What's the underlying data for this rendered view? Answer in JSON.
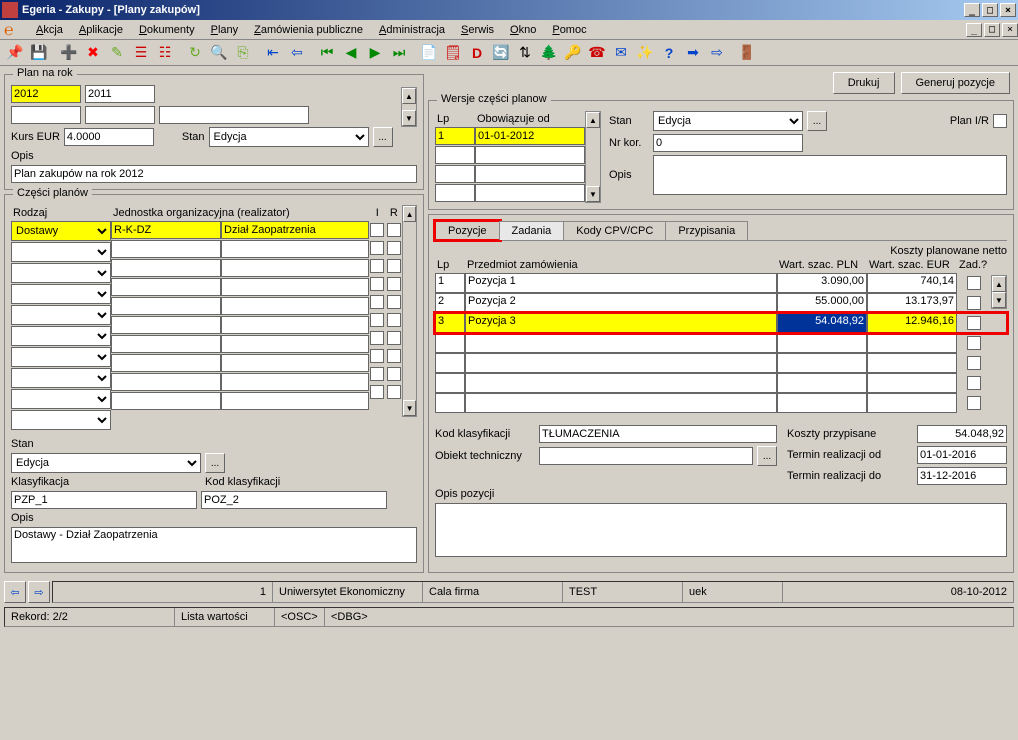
{
  "title": "Egeria - Zakupy - [Plany zakupów]",
  "menu": [
    "Akcja",
    "Aplikacje",
    "Dokumenty",
    "Plany",
    "Zamówienia publiczne",
    "Administracja",
    "Serwis",
    "Okno",
    "Pomoc"
  ],
  "buttons": {
    "print": "Drukuj",
    "gen": "Generuj pozycje"
  },
  "planrok": {
    "title": "Plan na rok",
    "year1": "2012",
    "year2": "2011",
    "kursLabel": "Kurs EUR",
    "kurs": "4.0000",
    "stanLabel": "Stan",
    "stan": "Edycja",
    "opisLabel": "Opis",
    "opis": "Plan zakupów na rok 2012"
  },
  "wersje": {
    "title": "Wersje części planow",
    "lpLabel": "Lp",
    "obowLabel": "Obowiązuje od",
    "lp": "1",
    "obow": "01-01-2012",
    "stanLabel": "Stan",
    "stan": "Edycja",
    "nrkorLabel": "Nr kor.",
    "nrkor": "0",
    "opisLabel": "Opis",
    "planirLabel": "Plan I/R"
  },
  "czesci": {
    "title": "Części planów",
    "rodzajLabel": "Rodzaj",
    "jedLabel": "Jednostka organizacyjna (realizator)",
    "iLabel": "I",
    "rLabel": "R",
    "rodzaj": "Dostawy",
    "jed1": "R-K-DZ",
    "jed2": "Dział Zaopatrzenia",
    "stanLabel": "Stan",
    "stan": "Edycja",
    "klasLabel": "Klasyfikacja",
    "klas": "PZP_1",
    "kodLabel": "Kod klasyfikacji",
    "kod": "POZ_2",
    "opisLabel": "Opis",
    "opis": "Dostawy - Dział Zaopatrzenia"
  },
  "tabs": {
    "pozycje": "Pozycje",
    "zadania": "Zadania",
    "kody": "Kody CPV/CPC",
    "przyp": "Przypisania"
  },
  "poz": {
    "kosztLabel": "Koszty planowane netto",
    "lpLabel": "Lp",
    "przedLabel": "Przedmiot zamówienia",
    "plnLabel": "Wart. szac. PLN",
    "eurLabel": "Wart. szac. EUR",
    "zadLabel": "Zad.?",
    "rows": [
      {
        "lp": "1",
        "prz": "Pozycja 1",
        "pln": "3.090,00",
        "eur": "740,14"
      },
      {
        "lp": "2",
        "prz": "Pozycja 2",
        "pln": "55.000,00",
        "eur": "13.173,97"
      },
      {
        "lp": "3",
        "prz": "Pozycja 3",
        "pln": "54.048,92",
        "eur": "12.946,16"
      }
    ],
    "kodklasLabel": "Kod klasyfikacji",
    "kodklas": "TŁUMACZENIA",
    "obiektLabel": "Obiekt techniczny",
    "kosztyPrzypLabel": "Koszty przypisane",
    "kosztyPrzyp": "54.048,92",
    "terminOdLabel": "Termin realizacji od",
    "terminOd": "01-01-2016",
    "terminDoLabel": "Termin realizacji do",
    "terminDo": "31-12-2016",
    "opisLabel": "Opis pozycji"
  },
  "status": {
    "num": "1",
    "uni": "Uniwersytet Ekonomiczny",
    "firma": "Cala firma",
    "test": "TEST",
    "uek": "uek",
    "date": "08-10-2012",
    "rekord": "Rekord: 2/2",
    "lista": "Lista wartości",
    "osc": "<OSC>",
    "dbg": "<DBG>"
  }
}
